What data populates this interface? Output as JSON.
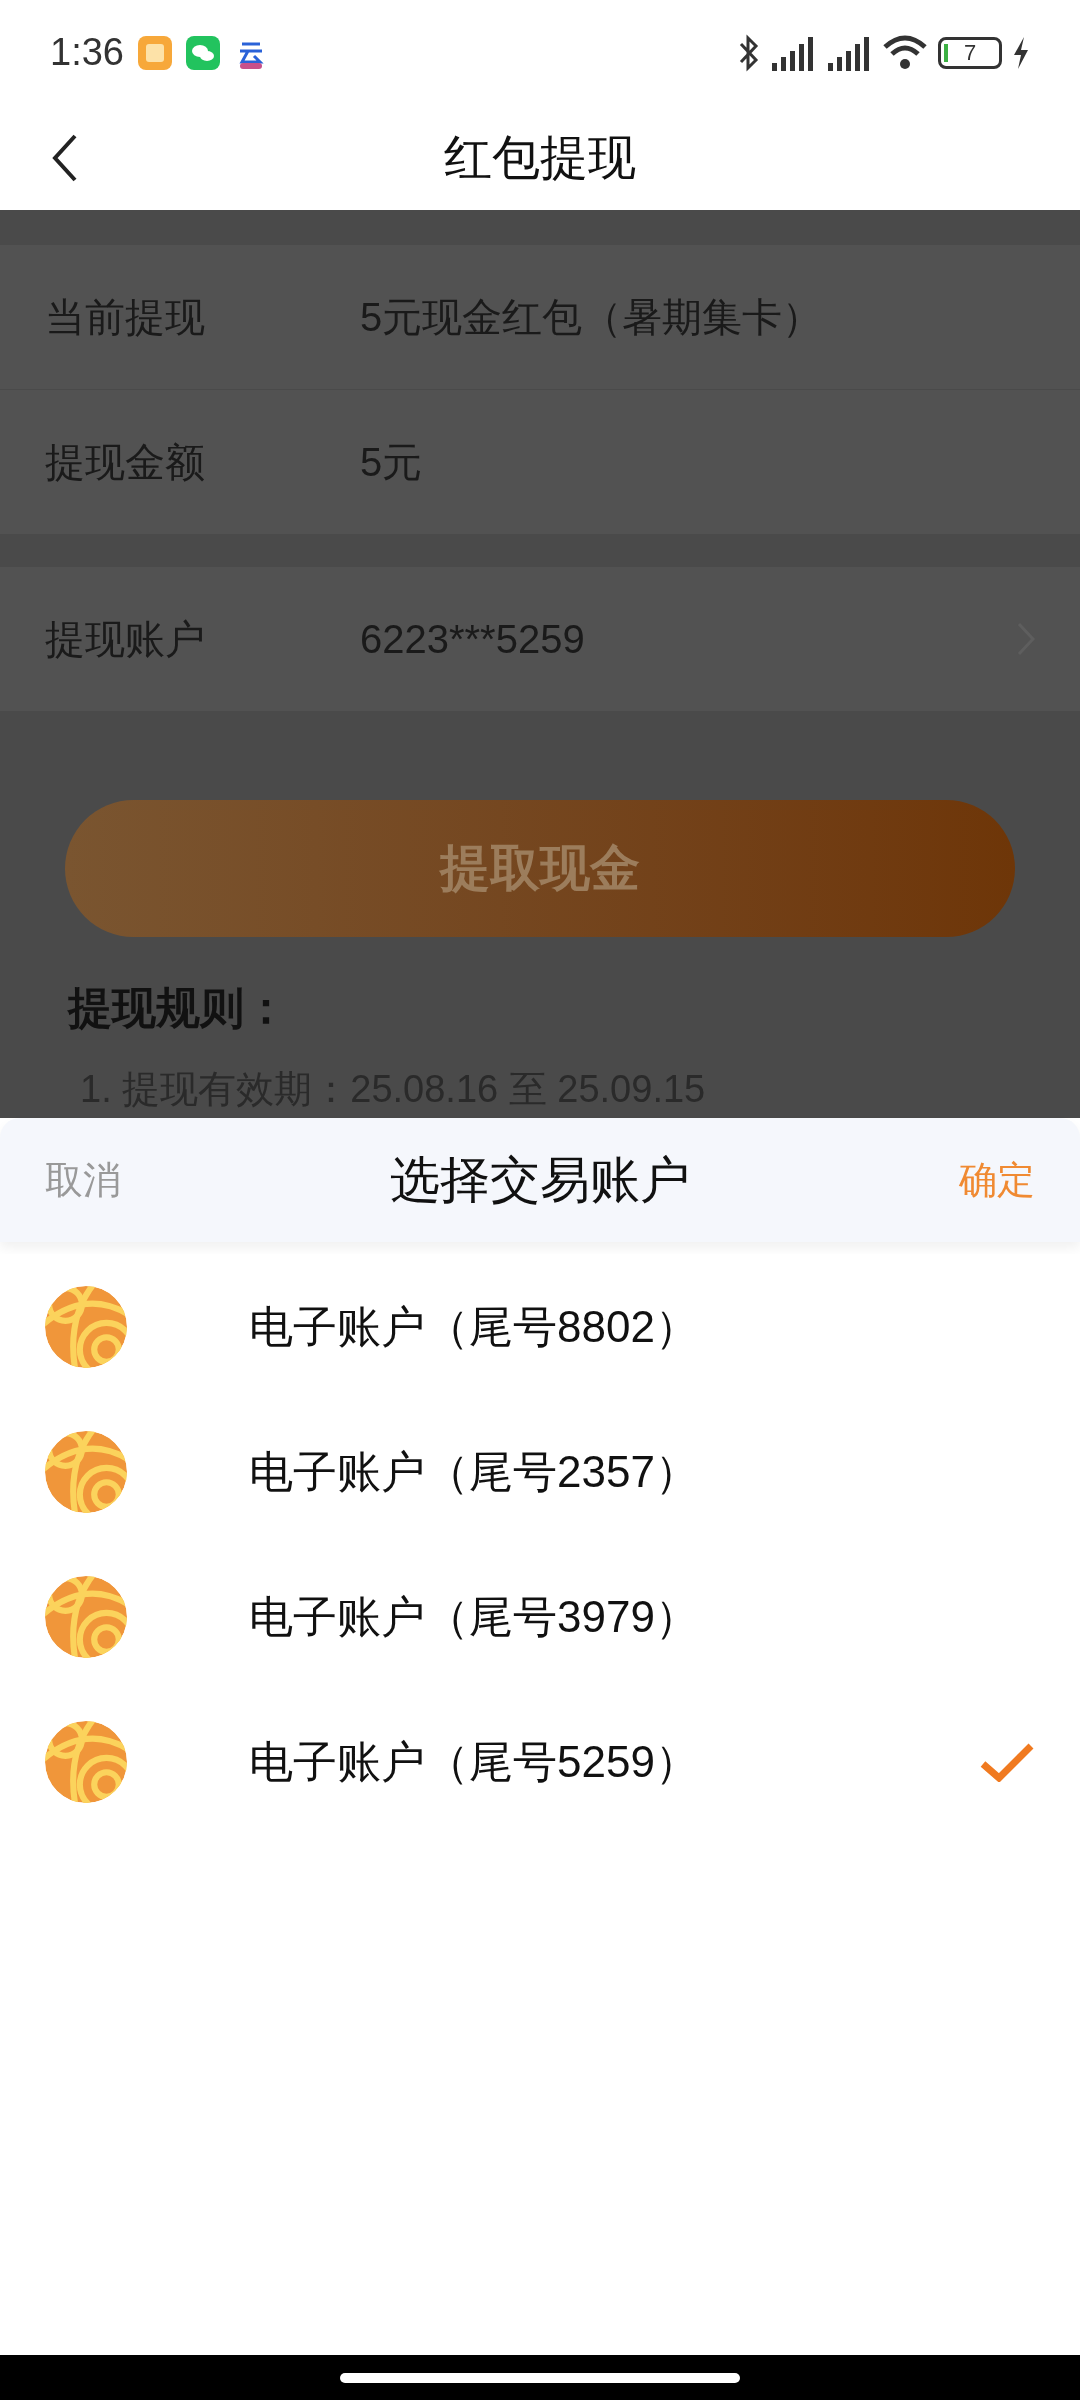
{
  "status_bar": {
    "time": "1:36",
    "battery": "7"
  },
  "header": {
    "title": "红包提现"
  },
  "form_groups": [
    {
      "rows": [
        {
          "label": "当前提现",
          "value": "5元现金红包（暑期集卡）",
          "kind": "text"
        },
        {
          "label": "提现金额",
          "value": "5元",
          "kind": "text"
        }
      ]
    },
    {
      "rows": [
        {
          "label": "提现账户",
          "value": "6223***5259",
          "kind": "link"
        }
      ]
    }
  ],
  "submit_button": {
    "label": "提取现金"
  },
  "rules": {
    "title": "提现规则：",
    "items": [
      "1. 提现有效期：25.08.16 至 25.09.15"
    ]
  },
  "sheet": {
    "cancel": "取消",
    "title": "选择交易账户",
    "confirm": "确定",
    "accounts": [
      {
        "name": "电子账户（尾号8802）",
        "selected": false
      },
      {
        "name": "电子账户（尾号2357）",
        "selected": false
      },
      {
        "name": "电子账户（尾号3979）",
        "selected": false
      },
      {
        "name": "电子账户（尾号5259）",
        "selected": true
      }
    ]
  }
}
